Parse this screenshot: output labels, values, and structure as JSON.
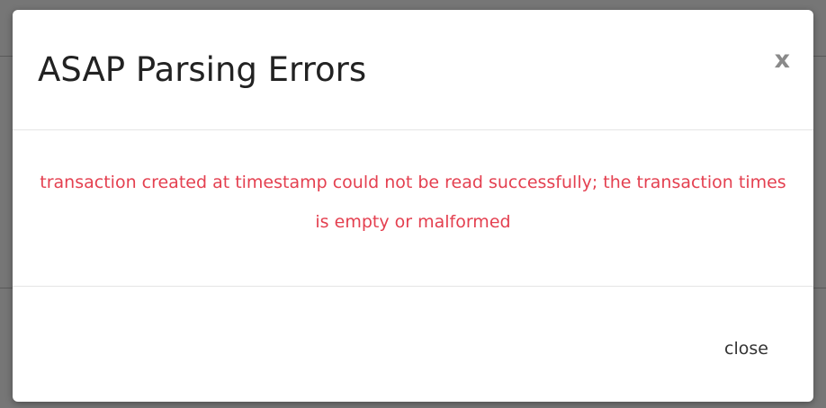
{
  "modal": {
    "title": "ASAP Parsing Errors",
    "close_icon_glyph": "x",
    "error_message": "transaction created at timestamp could not be read successfully; the transaction times is empty or malformed",
    "footer": {
      "close_label": "close"
    }
  },
  "colors": {
    "error_text": "#e44050",
    "backdrop": "#767676",
    "title_text": "#222222"
  }
}
